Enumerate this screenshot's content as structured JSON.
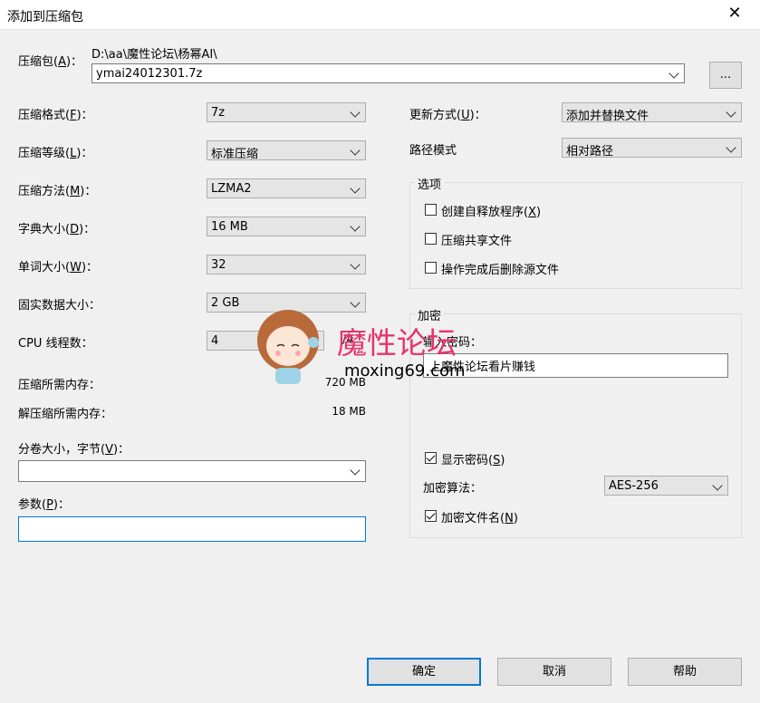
{
  "window": {
    "title": "添加到压缩包",
    "close_glyph": "✕"
  },
  "archive": {
    "label": "压缩包(",
    "label_key": "A",
    "label_end": ")：",
    "path": "D:\\aa\\魔性论坛\\杨幂AI\\",
    "filename": "ymai24012301.7z",
    "browse_label": "..."
  },
  "left": {
    "format": {
      "label": "压缩格式(",
      "key": "F",
      "end": ")：",
      "value": "7z"
    },
    "level": {
      "label": "压缩等级(",
      "key": "L",
      "end": ")：",
      "value": "标准压缩"
    },
    "method": {
      "label": "压缩方法(",
      "key": "M",
      "end": ")：",
      "value": "LZMA2"
    },
    "dict": {
      "label": "字典大小(",
      "key": "D",
      "end": ")：",
      "value": "16 MB"
    },
    "word": {
      "label": "单词大小(",
      "key": "W",
      "end": ")：",
      "value": "32"
    },
    "solid": {
      "label": "固实数据大小：",
      "value": "2 GB"
    },
    "threads": {
      "label": "CPU 线程数：",
      "value": "4",
      "total": "/4"
    },
    "mem_compress": {
      "label": "压缩所需内存：",
      "value": "720 MB"
    },
    "mem_decompress": {
      "label": "解压缩所需内存：",
      "value": "18 MB"
    },
    "volume": {
      "label": "分卷大小，字节(",
      "key": "V",
      "end": ")：",
      "value": ""
    },
    "params": {
      "label": "参数(",
      "key": "P",
      "end": ")：",
      "value": ""
    }
  },
  "right": {
    "update": {
      "label": "更新方式(",
      "key": "U",
      "end": ")：",
      "value": "添加并替换文件"
    },
    "path_mode": {
      "label": "路径模式",
      "value": "相对路径"
    },
    "options": {
      "title": "选项",
      "sfx": {
        "label": "创建自释放程序(",
        "key": "X",
        "end": ")",
        "checked": false
      },
      "shared": {
        "label": "压缩共享文件",
        "checked": false
      },
      "delete": {
        "label": "操作完成后删除源文件",
        "checked": false
      }
    },
    "encryption": {
      "title": "加密",
      "password_label": "输入密码：",
      "password_value": "上魔性论坛看片赚钱",
      "show_password": {
        "label": "显示密码(",
        "key": "S",
        "end": ")",
        "checked": true
      },
      "method_label": "加密算法：",
      "method_value": "AES-256",
      "encrypt_names": {
        "label": "加密文件名(",
        "key": "N",
        "end": ")",
        "checked": true
      }
    }
  },
  "buttons": {
    "ok": "确定",
    "cancel": "取消",
    "help": "帮助"
  },
  "watermark": {
    "text_cn": "魔性论坛",
    "text_url": "moxing69.com"
  },
  "colors": {
    "accent": "#0078d7",
    "watermark": "#e8336e"
  }
}
